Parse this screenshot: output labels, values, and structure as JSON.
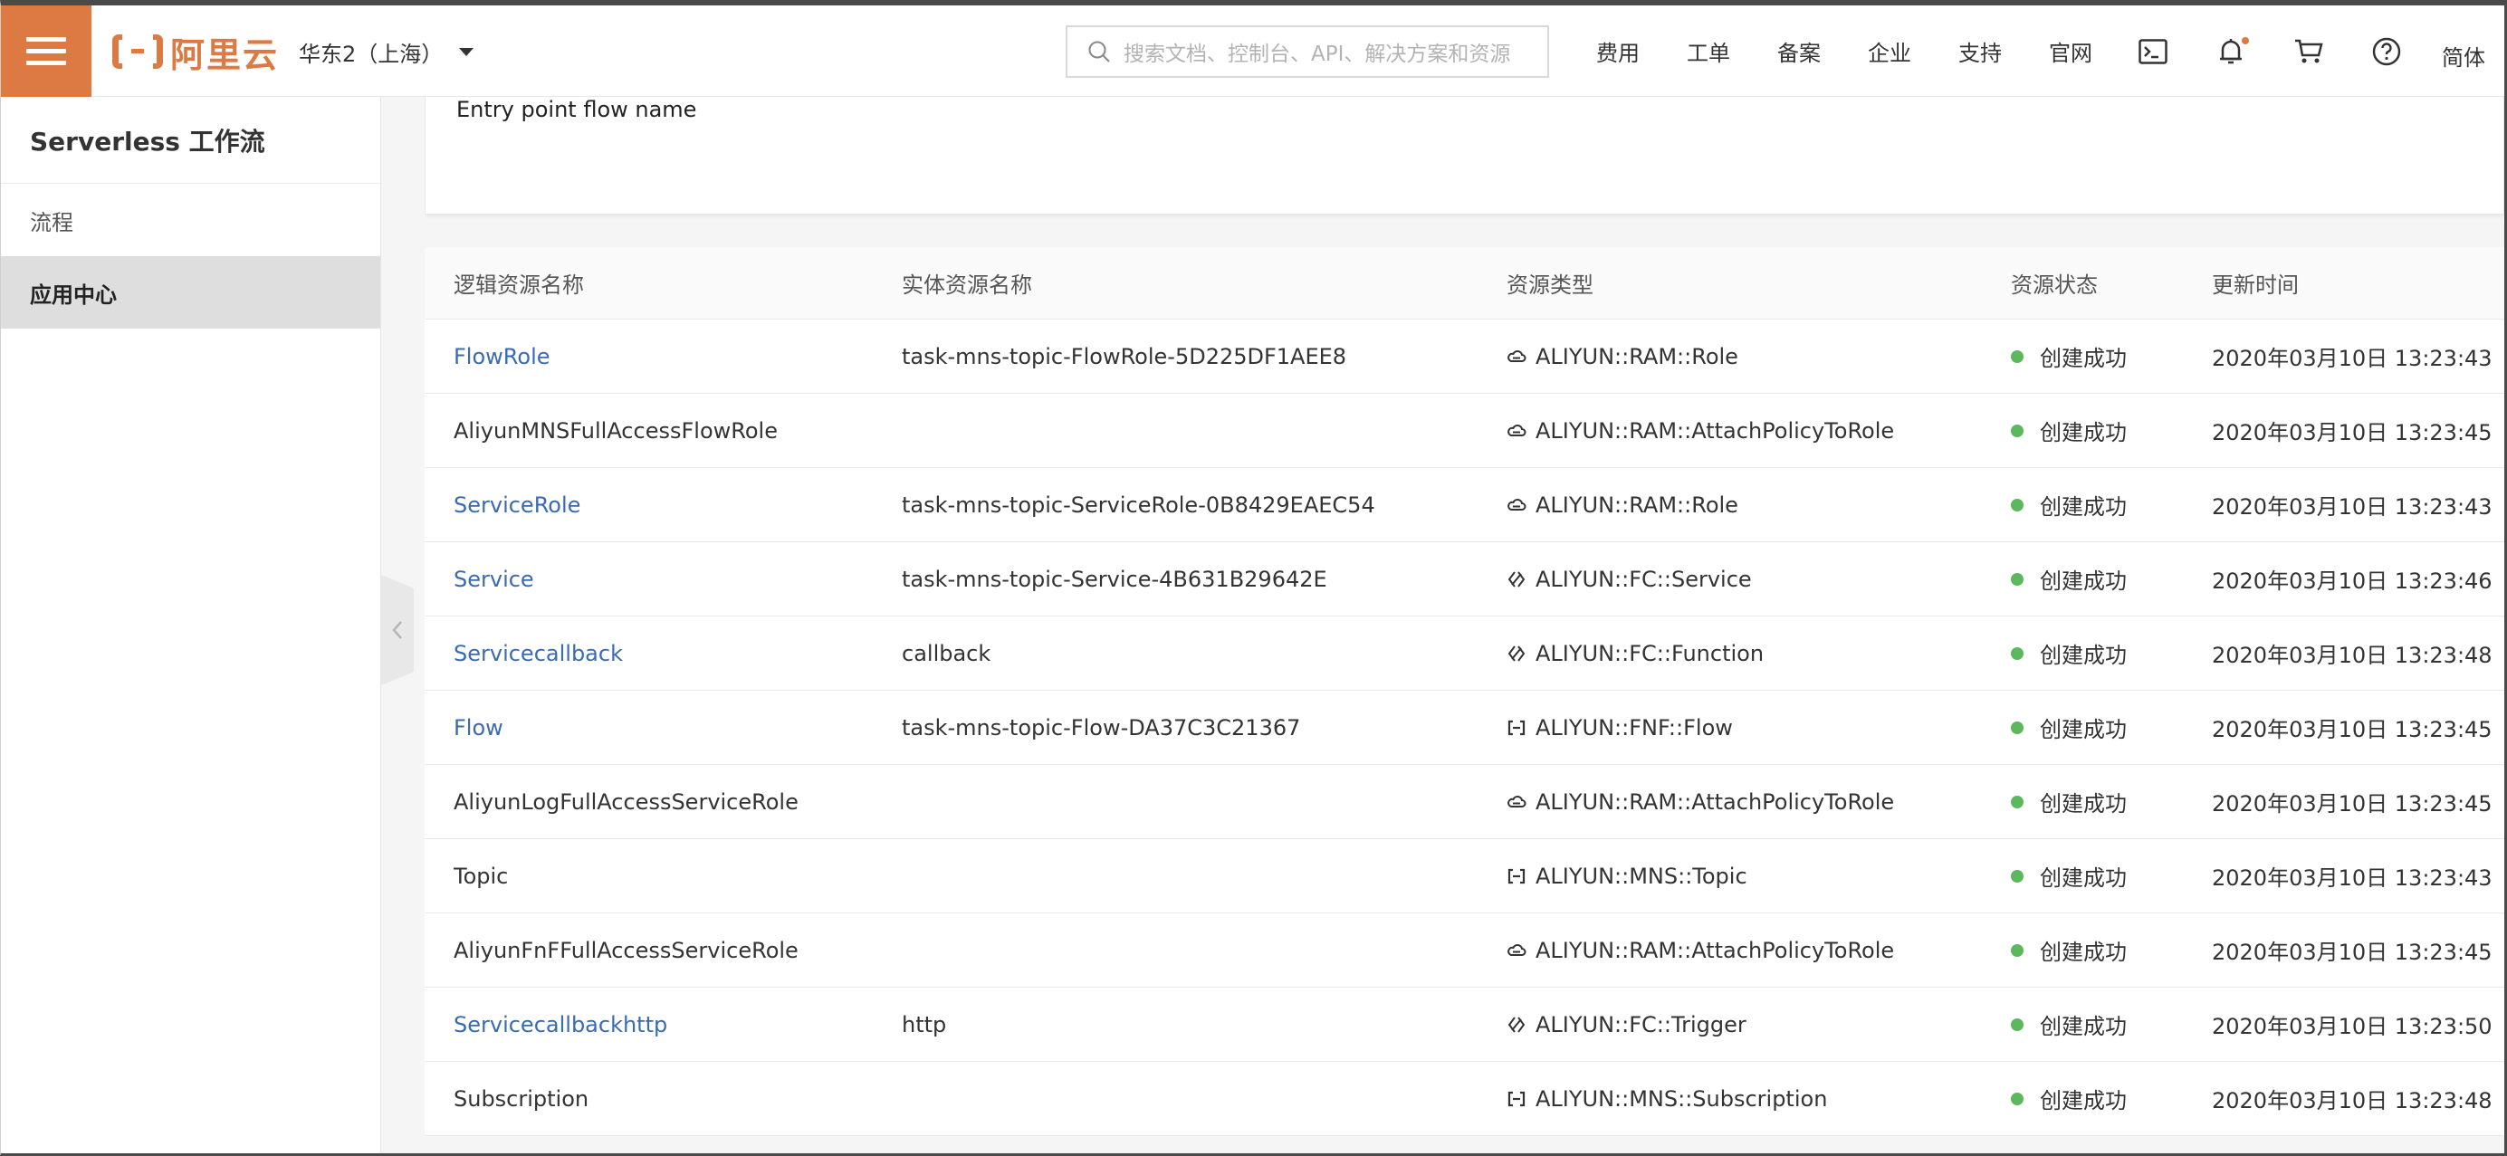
{
  "header": {
    "logo_text": "阿里云",
    "region": "华东2（上海）",
    "search_placeholder": "搜索文档、控制台、API、解决方案和资源",
    "nav_links": [
      "费用",
      "工单",
      "备案",
      "企业",
      "支持",
      "官网"
    ],
    "icons": [
      "terminal-icon",
      "bell-icon",
      "cart-icon",
      "help-icon"
    ],
    "language": "简体",
    "accent_color": "#dd7a44"
  },
  "sidebar": {
    "title": "Serverless 工作流",
    "items": [
      {
        "label": "流程",
        "active": false
      },
      {
        "label": "应用中心",
        "active": true
      }
    ]
  },
  "card": {
    "label": "Entry point flow name"
  },
  "table": {
    "columns": [
      "逻辑资源名称",
      "实体资源名称",
      "资源类型",
      "资源状态",
      "更新时间"
    ],
    "rows": [
      {
        "logical": "FlowRole",
        "link": true,
        "physical": "task-mns-topic-FlowRole-5D225DF1AEE8",
        "type": "ALIYUN::RAM::Role",
        "icon": "cloud-icon",
        "status": "创建成功",
        "time": "2020年03月10日 13:23:43"
      },
      {
        "logical": "AliyunMNSFullAccessFlowRole",
        "link": false,
        "physical": "",
        "type": "ALIYUN::RAM::AttachPolicyToRole",
        "icon": "cloud-icon",
        "status": "创建成功",
        "time": "2020年03月10日 13:23:45"
      },
      {
        "logical": "ServiceRole",
        "link": true,
        "physical": "task-mns-topic-ServiceRole-0B8429EAEC54",
        "type": "ALIYUN::RAM::Role",
        "icon": "cloud-icon",
        "status": "创建成功",
        "time": "2020年03月10日 13:23:43"
      },
      {
        "logical": "Service",
        "link": true,
        "physical": "task-mns-topic-Service-4B631B29642E",
        "type": "ALIYUN::FC::Service",
        "icon": "function-compute-icon",
        "status": "创建成功",
        "time": "2020年03月10日 13:23:46"
      },
      {
        "logical": "Servicecallback",
        "link": true,
        "physical": "callback",
        "type": "ALIYUN::FC::Function",
        "icon": "function-compute-icon",
        "status": "创建成功",
        "time": "2020年03月10日 13:23:48"
      },
      {
        "logical": "Flow",
        "link": true,
        "physical": "task-mns-topic-Flow-DA37C3C21367",
        "type": "ALIYUN::FNF::Flow",
        "icon": "bracket-icon",
        "status": "创建成功",
        "time": "2020年03月10日 13:23:45"
      },
      {
        "logical": "AliyunLogFullAccessServiceRole",
        "link": false,
        "physical": "",
        "type": "ALIYUN::RAM::AttachPolicyToRole",
        "icon": "cloud-icon",
        "status": "创建成功",
        "time": "2020年03月10日 13:23:45"
      },
      {
        "logical": "Topic",
        "link": false,
        "physical": "",
        "type": "ALIYUN::MNS::Topic",
        "icon": "bracket-icon",
        "status": "创建成功",
        "time": "2020年03月10日 13:23:43"
      },
      {
        "logical": "AliyunFnFFullAccessServiceRole",
        "link": false,
        "physical": "",
        "type": "ALIYUN::RAM::AttachPolicyToRole",
        "icon": "cloud-icon",
        "status": "创建成功",
        "time": "2020年03月10日 13:23:45"
      },
      {
        "logical": "Servicecallbackhttp",
        "link": true,
        "physical": "http",
        "type": "ALIYUN::FC::Trigger",
        "icon": "function-compute-icon",
        "status": "创建成功",
        "time": "2020年03月10日 13:23:50"
      },
      {
        "logical": "Subscription",
        "link": false,
        "physical": "",
        "type": "ALIYUN::MNS::Subscription",
        "icon": "bracket-icon",
        "status": "创建成功",
        "time": "2020年03月10日 13:23:48"
      }
    ]
  }
}
